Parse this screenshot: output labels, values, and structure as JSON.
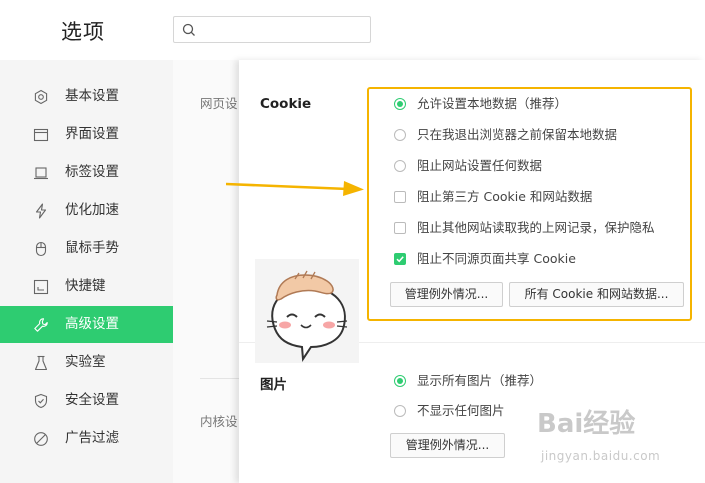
{
  "header": {
    "title": "选项",
    "search_placeholder": ""
  },
  "sidebar": {
    "items": [
      {
        "label": "基本设置",
        "icon": "gear-icon"
      },
      {
        "label": "界面设置",
        "icon": "window-icon"
      },
      {
        "label": "标签设置",
        "icon": "tab-icon"
      },
      {
        "label": "优化加速",
        "icon": "lightning-icon"
      },
      {
        "label": "鼠标手势",
        "icon": "mouse-icon"
      },
      {
        "label": "快捷键",
        "icon": "keyboard-icon"
      },
      {
        "label": "高级设置",
        "icon": "wrench-icon",
        "active": true
      },
      {
        "label": "实验室",
        "icon": "flask-icon"
      },
      {
        "label": "安全设置",
        "icon": "shield-icon"
      },
      {
        "label": "广告过滤",
        "icon": "block-icon"
      }
    ]
  },
  "mid": {
    "label_1": "网页设",
    "label_2": "内核设"
  },
  "cookie": {
    "title": "Cookie",
    "options": [
      {
        "type": "radio",
        "label": "允许设置本地数据（推荐）",
        "checked": true
      },
      {
        "type": "radio",
        "label": "只在我退出浏览器之前保留本地数据",
        "checked": false
      },
      {
        "type": "radio",
        "label": "阻止网站设置任何数据",
        "checked": false
      },
      {
        "type": "checkbox",
        "label": "阻止第三方 Cookie 和网站数据",
        "checked": false
      },
      {
        "type": "checkbox",
        "label": "阻止其他网站读取我的上网记录，保护隐私",
        "checked": false
      },
      {
        "type": "checkbox",
        "label": "阻止不同源页面共享 Cookie",
        "checked": true
      }
    ],
    "btn_exceptions": "管理例外情况...",
    "btn_all_cookies": "所有 Cookie 和网站数据..."
  },
  "images": {
    "title": "图片",
    "options": [
      {
        "type": "radio",
        "label": "显示所有图片（推荐）",
        "checked": true
      },
      {
        "type": "radio",
        "label": "不显示任何图片",
        "checked": false
      }
    ],
    "btn_exceptions": "管理例外情况..."
  },
  "watermark": {
    "brand": "Bai经验",
    "url": "jingyan.baidu.com"
  },
  "colors": {
    "accent": "#2ecc71",
    "highlight": "#f5b400"
  }
}
